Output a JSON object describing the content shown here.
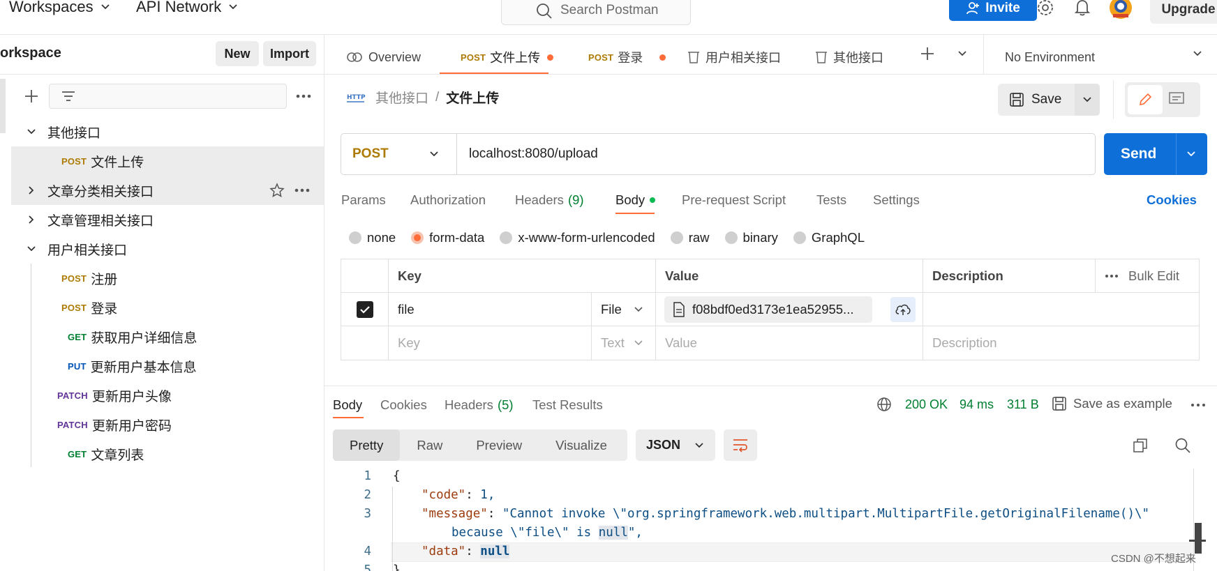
{
  "topbar": {
    "workspaces_label": "Workspaces",
    "api_network_label": "API Network",
    "search_placeholder": "Search Postman",
    "invite_label": "Invite",
    "upgrade_label": "Upgrade"
  },
  "sidebar": {
    "workspace_title": "orkspace",
    "new_label": "New",
    "import_label": "Import",
    "tree": [
      {
        "type": "folder",
        "label": "其他接口",
        "expanded": true
      },
      {
        "type": "request",
        "method": "POST",
        "label": "文件上传",
        "selected": true
      },
      {
        "type": "folder",
        "label": "文章分类相关接口",
        "expanded": false
      },
      {
        "type": "folder",
        "label": "文章管理相关接口",
        "expanded": false
      },
      {
        "type": "folder",
        "label": "用户相关接口",
        "expanded": true
      },
      {
        "type": "request",
        "method": "POST",
        "label": "注册"
      },
      {
        "type": "request",
        "method": "POST",
        "label": "登录"
      },
      {
        "type": "request",
        "method": "GET",
        "label": "获取用户详细信息"
      },
      {
        "type": "request",
        "method": "PUT",
        "label": "更新用户基本信息"
      },
      {
        "type": "request",
        "method": "PATCH",
        "label": "更新用户头像"
      },
      {
        "type": "request",
        "method": "PATCH",
        "label": "更新用户密码"
      },
      {
        "type": "request",
        "method": "GET",
        "label": "文章列表"
      }
    ]
  },
  "tabs": {
    "overview": "Overview",
    "tab1_method": "POST",
    "tab1_label": "文件上传",
    "tab2_method": "POST",
    "tab2_label": "登录",
    "tab3_label": "用户相关接口",
    "tab4_label": "其他接口",
    "environment": "No Environment"
  },
  "request": {
    "breadcrumb_parent": "其他接口",
    "breadcrumb_sep": "/",
    "breadcrumb_current": "文件上传",
    "save_label": "Save",
    "method": "POST",
    "url": "localhost:8080/upload",
    "send_label": "Send",
    "tabs": {
      "params": "Params",
      "authorization": "Authorization",
      "headers": "Headers",
      "headers_count": "(9)",
      "body": "Body",
      "prerequest": "Pre-request Script",
      "tests": "Tests",
      "settings": "Settings",
      "cookies": "Cookies"
    },
    "body_modes": [
      "none",
      "form-data",
      "x-www-form-urlencoded",
      "raw",
      "binary",
      "GraphQL"
    ],
    "body_mode_selected": "form-data",
    "table": {
      "headers": {
        "key": "Key",
        "value": "Value",
        "description": "Description",
        "bulk_edit": "Bulk Edit"
      },
      "row1": {
        "key": "file",
        "type": "File",
        "value": "f08bdf0ed3173e1ea52955...",
        "checked": true
      },
      "row2": {
        "key_placeholder": "Key",
        "type": "Text",
        "value_placeholder": "Value",
        "description_placeholder": "Description"
      }
    }
  },
  "response": {
    "tabs": {
      "body": "Body",
      "cookies": "Cookies",
      "headers": "Headers",
      "headers_count": "(5)",
      "test_results": "Test Results"
    },
    "status": "200 OK",
    "time": "94 ms",
    "size": "311 B",
    "save_example": "Save as example",
    "views": [
      "Pretty",
      "Raw",
      "Preview",
      "Visualize"
    ],
    "format": "JSON",
    "code_lines": [
      {
        "num": "1",
        "text": "{"
      },
      {
        "num": "2",
        "key": "\"code\"",
        "value": "1,"
      },
      {
        "num": "3",
        "key": "\"message\"",
        "value": "\"Cannot invoke \\\"org.springframework.web.multipart.MultipartFile.getOriginalFilename()\\\"",
        "cont_before": "because \\\"file\\\" is ",
        "cont_null": "null",
        "cont_after": "\","
      },
      {
        "num": "4",
        "key": "\"data\"",
        "value": "null"
      },
      {
        "num": "5",
        "text": "}"
      }
    ]
  },
  "watermark": "CSDN @不想起来",
  "colors": {
    "accent_orange": "#ff6c37",
    "brand_blue": "#0f6fd8",
    "status_green": "#007f31",
    "post_color": "#ad7a03"
  }
}
